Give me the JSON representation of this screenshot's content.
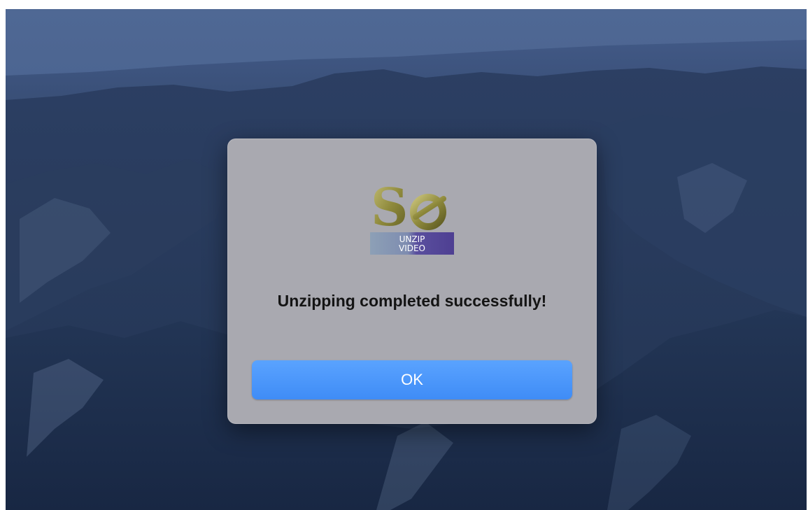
{
  "dialog": {
    "message": "Unzipping completed successfully!",
    "ok_label": "OK",
    "icon": "se-unzip-video-app-icon",
    "icon_lettering": [
      "Se",
      "UNZIP",
      "VIDEO"
    ]
  },
  "colors": {
    "button": "#3f8cf6",
    "dialog_background": "#a9a9b0",
    "icon_banner": "#5a4f9e"
  }
}
